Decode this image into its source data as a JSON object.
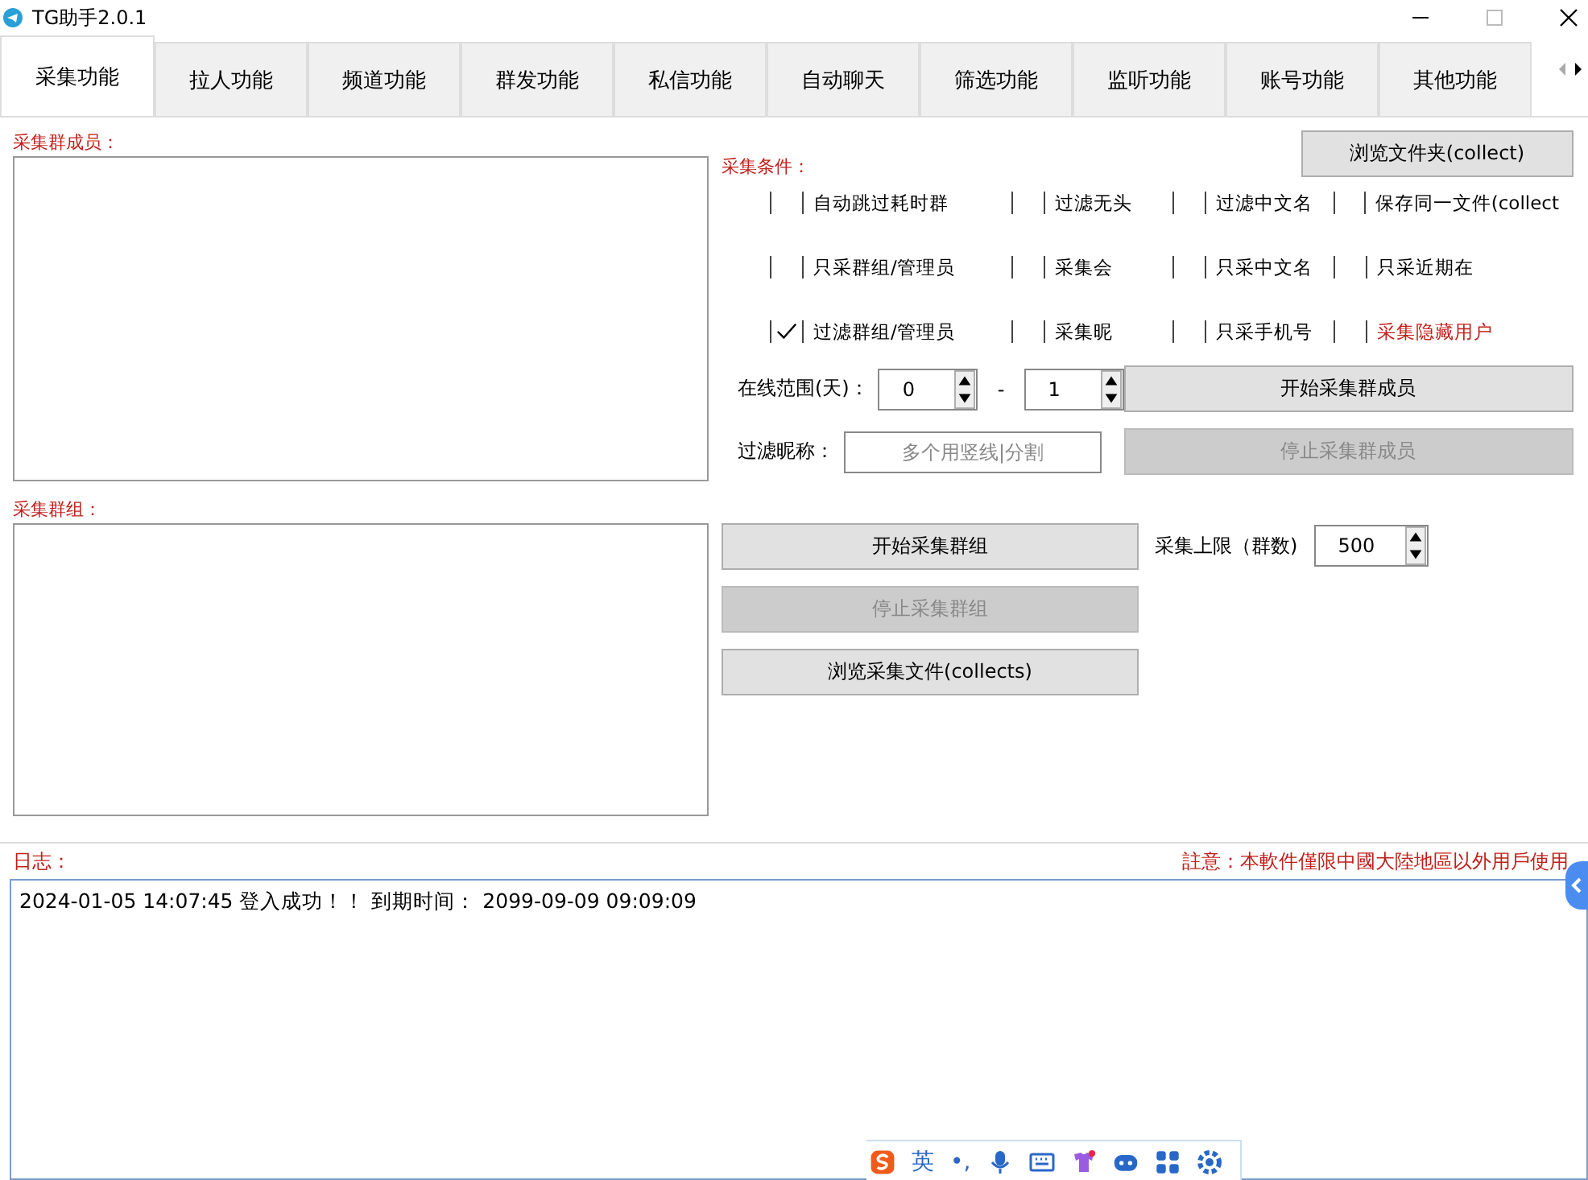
{
  "window": {
    "title": "TG助手2.0.1"
  },
  "tabs": [
    {
      "label": "采集功能",
      "selected": true
    },
    {
      "label": "拉人功能",
      "selected": false
    },
    {
      "label": "频道功能",
      "selected": false
    },
    {
      "label": "群发功能",
      "selected": false
    },
    {
      "label": "私信功能",
      "selected": false
    },
    {
      "label": "自动聊天",
      "selected": false
    },
    {
      "label": "筛选功能",
      "selected": false
    },
    {
      "label": "监听功能",
      "selected": false
    },
    {
      "label": "账号功能",
      "selected": false
    },
    {
      "label": "其他功能",
      "selected": false
    }
  ],
  "members_label": "采集群成员：",
  "groups_label": "采集群组：",
  "browse_folder_button": "浏览文件夹(collect)",
  "conditions_label": "采集条件：",
  "options": [
    {
      "label": "自动跳过耗时群",
      "checked": false,
      "highlight": false
    },
    {
      "label": "过滤无头",
      "checked": false,
      "highlight": false
    },
    {
      "label": "过滤中文名",
      "checked": false,
      "highlight": false
    },
    {
      "label": "保存同一文件(collect",
      "checked": false,
      "highlight": false
    },
    {
      "label": "只采群组/管理员",
      "checked": false,
      "highlight": false
    },
    {
      "label": "采集会",
      "checked": false,
      "highlight": false
    },
    {
      "label": "只采中文名",
      "checked": false,
      "highlight": false
    },
    {
      "label": "只采近期在",
      "checked": false,
      "highlight": false
    },
    {
      "label": "过滤群组/管理员",
      "checked": true,
      "highlight": false
    },
    {
      "label": "采集昵",
      "checked": false,
      "highlight": false
    },
    {
      "label": "只采手机号",
      "checked": false,
      "highlight": false
    },
    {
      "label": "采集隐藏用户",
      "checked": false,
      "highlight": true
    }
  ],
  "online_range": {
    "label": "在线范围(天)：",
    "from": "0",
    "separator": "-",
    "to": "1"
  },
  "start_members_button": {
    "label": "开始采集群成员",
    "disabled": false
  },
  "nickname_filter": {
    "label": "过滤昵称：",
    "placeholder": "多个用竖线|分割"
  },
  "stop_members_button": {
    "label": "停止采集群成员",
    "disabled": true
  },
  "group_buttons": [
    {
      "label": "开始采集群组",
      "disabled": false
    },
    {
      "label": "停止采集群组",
      "disabled": true
    },
    {
      "label": "浏览采集文件(collects)",
      "disabled": false
    }
  ],
  "limit": {
    "label": "采集上限（群数)",
    "value": "500"
  },
  "log_label": "日志：",
  "notice": "註意：本軟件僅限中國大陸地區以外用戶使用",
  "log_lines": [
    "2024-01-05 14:07:45 登入成功！！ 到期时间： 2099-09-09 09:09:09"
  ],
  "ime_toolbar": {
    "mode": "英",
    "punct": "•,"
  }
}
